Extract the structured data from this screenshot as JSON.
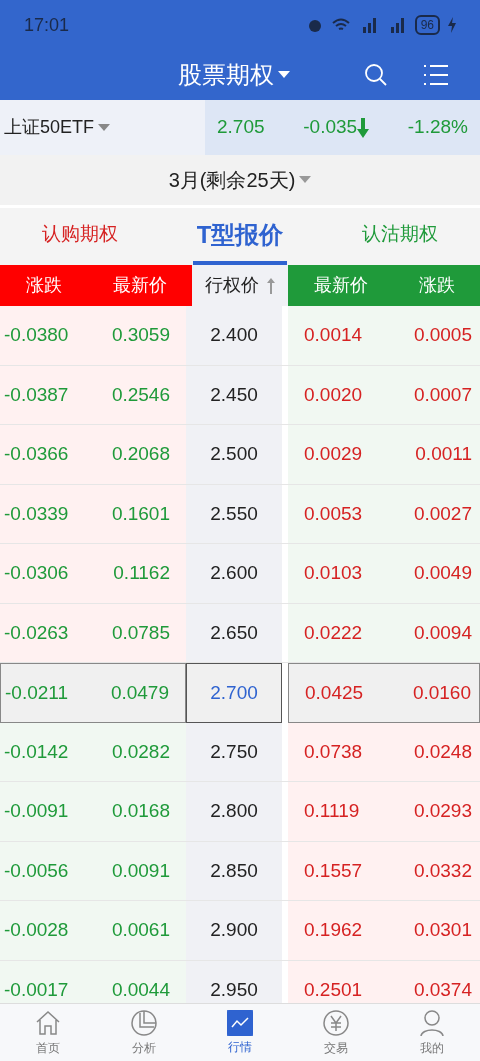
{
  "status_bar": {
    "time": "17:01",
    "battery": "96"
  },
  "header": {
    "title": "股票期权"
  },
  "underlying": {
    "name": "上证50ETF",
    "price": "2.705",
    "change": "-0.035",
    "change_pct": "-1.28%"
  },
  "expiry": {
    "label": "3月(剩余25天)"
  },
  "tabs": [
    {
      "label": "认购期权",
      "selected": false,
      "kind": "call"
    },
    {
      "label": "T型报价",
      "selected": true,
      "kind": "t"
    },
    {
      "label": "认沽期权",
      "selected": false,
      "kind": "put"
    }
  ],
  "columns": {
    "call": [
      "涨跌",
      "最新价"
    ],
    "strike": "行权价",
    "put": [
      "最新价",
      "涨跌"
    ]
  },
  "rows": [
    {
      "kind": "call_itm",
      "call_change": "-0.0380",
      "call_price": "0.3059",
      "strike": "2.400",
      "put_price": "0.0014",
      "put_change": "0.0005"
    },
    {
      "kind": "call_itm",
      "call_change": "-0.0387",
      "call_price": "0.2546",
      "strike": "2.450",
      "put_price": "0.0020",
      "put_change": "0.0007"
    },
    {
      "kind": "call_itm",
      "call_change": "-0.0366",
      "call_price": "0.2068",
      "strike": "2.500",
      "put_price": "0.0029",
      "put_change": "0.0011"
    },
    {
      "kind": "call_itm",
      "call_change": "-0.0339",
      "call_price": "0.1601",
      "strike": "2.550",
      "put_price": "0.0053",
      "put_change": "0.0027"
    },
    {
      "kind": "call_itm",
      "call_change": "-0.0306",
      "call_price": "0.1162",
      "strike": "2.600",
      "put_price": "0.0103",
      "put_change": "0.0049"
    },
    {
      "kind": "call_itm",
      "call_change": "-0.0263",
      "call_price": "0.0785",
      "strike": "2.650",
      "put_price": "0.0222",
      "put_change": "0.0094"
    },
    {
      "kind": "atm",
      "call_change": "-0.0211",
      "call_price": "0.0479",
      "strike": "2.700",
      "put_price": "0.0425",
      "put_change": "0.0160"
    },
    {
      "kind": "put_itm",
      "call_change": "-0.0142",
      "call_price": "0.0282",
      "strike": "2.750",
      "put_price": "0.0738",
      "put_change": "0.0248"
    },
    {
      "kind": "put_itm",
      "call_change": "-0.0091",
      "call_price": "0.0168",
      "strike": "2.800",
      "put_price": "0.1119",
      "put_change": "0.0293"
    },
    {
      "kind": "put_itm",
      "call_change": "-0.0056",
      "call_price": "0.0091",
      "strike": "2.850",
      "put_price": "0.1557",
      "put_change": "0.0332"
    },
    {
      "kind": "put_itm",
      "call_change": "-0.0028",
      "call_price": "0.0061",
      "strike": "2.900",
      "put_price": "0.1962",
      "put_change": "0.0301"
    },
    {
      "kind": "put_itm",
      "call_change": "-0.0017",
      "call_price": "0.0044",
      "strike": "2.950",
      "put_price": "0.2501",
      "put_change": "0.0374"
    }
  ],
  "nav": [
    {
      "label": "首页",
      "kind": "home",
      "selected": false
    },
    {
      "label": "分析",
      "kind": "pie",
      "selected": false
    },
    {
      "label": "行情",
      "kind": "chart",
      "selected": true
    },
    {
      "label": "交易",
      "kind": "yen",
      "selected": false
    },
    {
      "label": "我的",
      "kind": "user",
      "selected": false
    }
  ]
}
